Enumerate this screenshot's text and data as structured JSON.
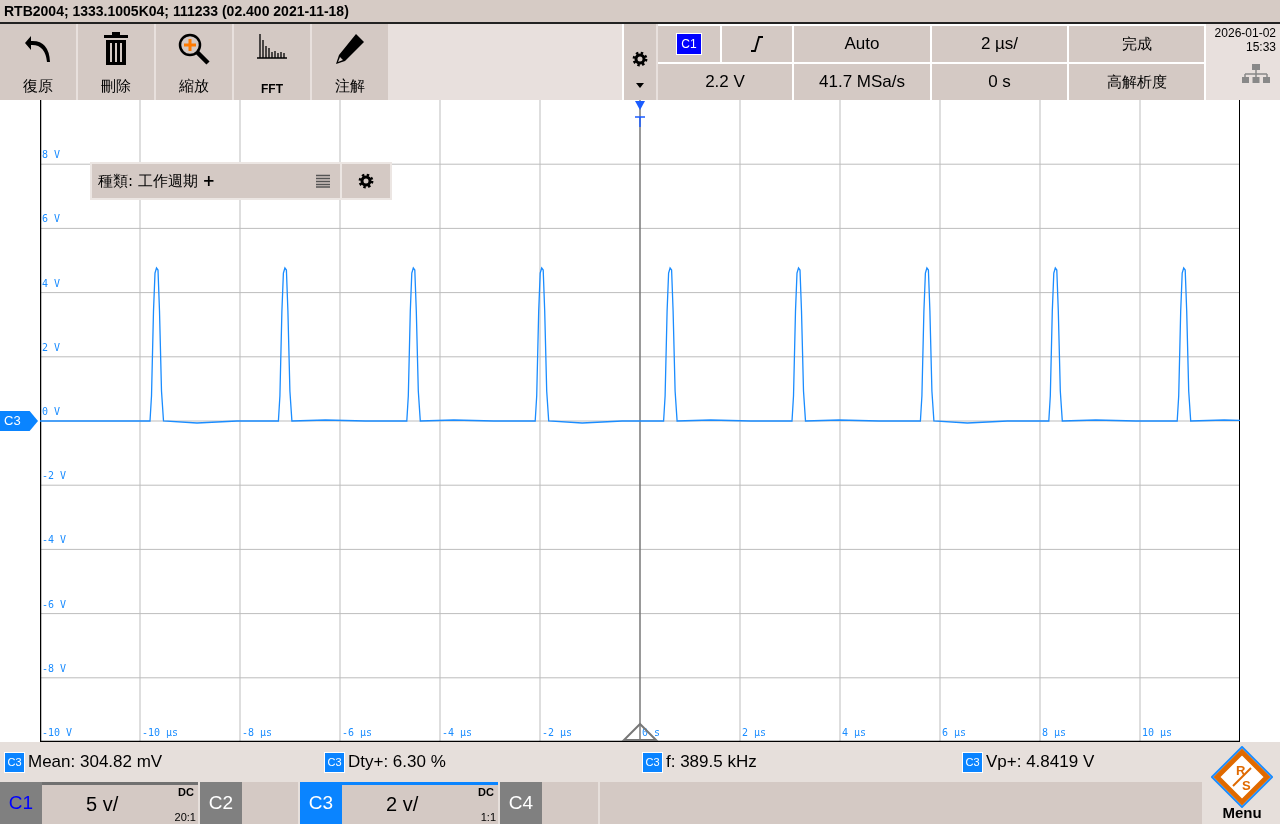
{
  "title": "RTB2004; 1333.1005K04; 111233 (02.400 2021-11-18)",
  "toolbar": [
    {
      "kind": "undo",
      "label": "復原"
    },
    {
      "kind": "delete",
      "label": "刪除"
    },
    {
      "kind": "zoom",
      "label": "縮放"
    },
    {
      "kind": "fft",
      "label": "FFT"
    },
    {
      "kind": "annotate",
      "label": "注解"
    }
  ],
  "trigger": {
    "source": "C1",
    "mode": "Auto",
    "timebase": "2 µs/",
    "status": "完成",
    "level": "2.2 V",
    "sample_rate": "41.7 MSa/s",
    "position": "0 s",
    "acquisition": "高解析度"
  },
  "clock": {
    "date": "2026-01-02",
    "time": "15:33"
  },
  "plot": {
    "marker": "C3",
    "y_labels": [
      "8 V",
      "6 V",
      "4 V",
      "2 V",
      "0 V",
      "-2 V",
      "-4 V",
      "-6 V",
      "-8 V",
      "-10 V"
    ],
    "x_labels": [
      "-10 µs",
      "-8 µs",
      "-6 µs",
      "-4 µs",
      "-2 µs",
      "0 s",
      "2 µs",
      "4 µs",
      "6 µs",
      "8 µs",
      "10 µs"
    ]
  },
  "measure_panel": {
    "label": "種類: 工作週期 **+**"
  },
  "measurements": [
    {
      "source": "C3",
      "text": "Mean: 304.82 mV"
    },
    {
      "source": "C3",
      "text": "Dty+: 6.30 %"
    },
    {
      "source": "C3",
      "text": "f: 389.5 kHz"
    },
    {
      "source": "C3",
      "text": "Vp+: 4.8419 V"
    }
  ],
  "channels": [
    {
      "name": "C1",
      "on": true,
      "selected": false,
      "scale": "5 v/",
      "coupling": "DC",
      "probe": "20:1"
    },
    {
      "name": "C2",
      "on": false,
      "selected": false
    },
    {
      "name": "C3",
      "on": true,
      "selected": true,
      "scale": "2 v/",
      "coupling": "DC",
      "probe": "1:1"
    },
    {
      "name": "C4",
      "on": false,
      "selected": false
    }
  ],
  "menu": {
    "logo": [
      "R",
      "S"
    ],
    "label": "Menu"
  }
}
